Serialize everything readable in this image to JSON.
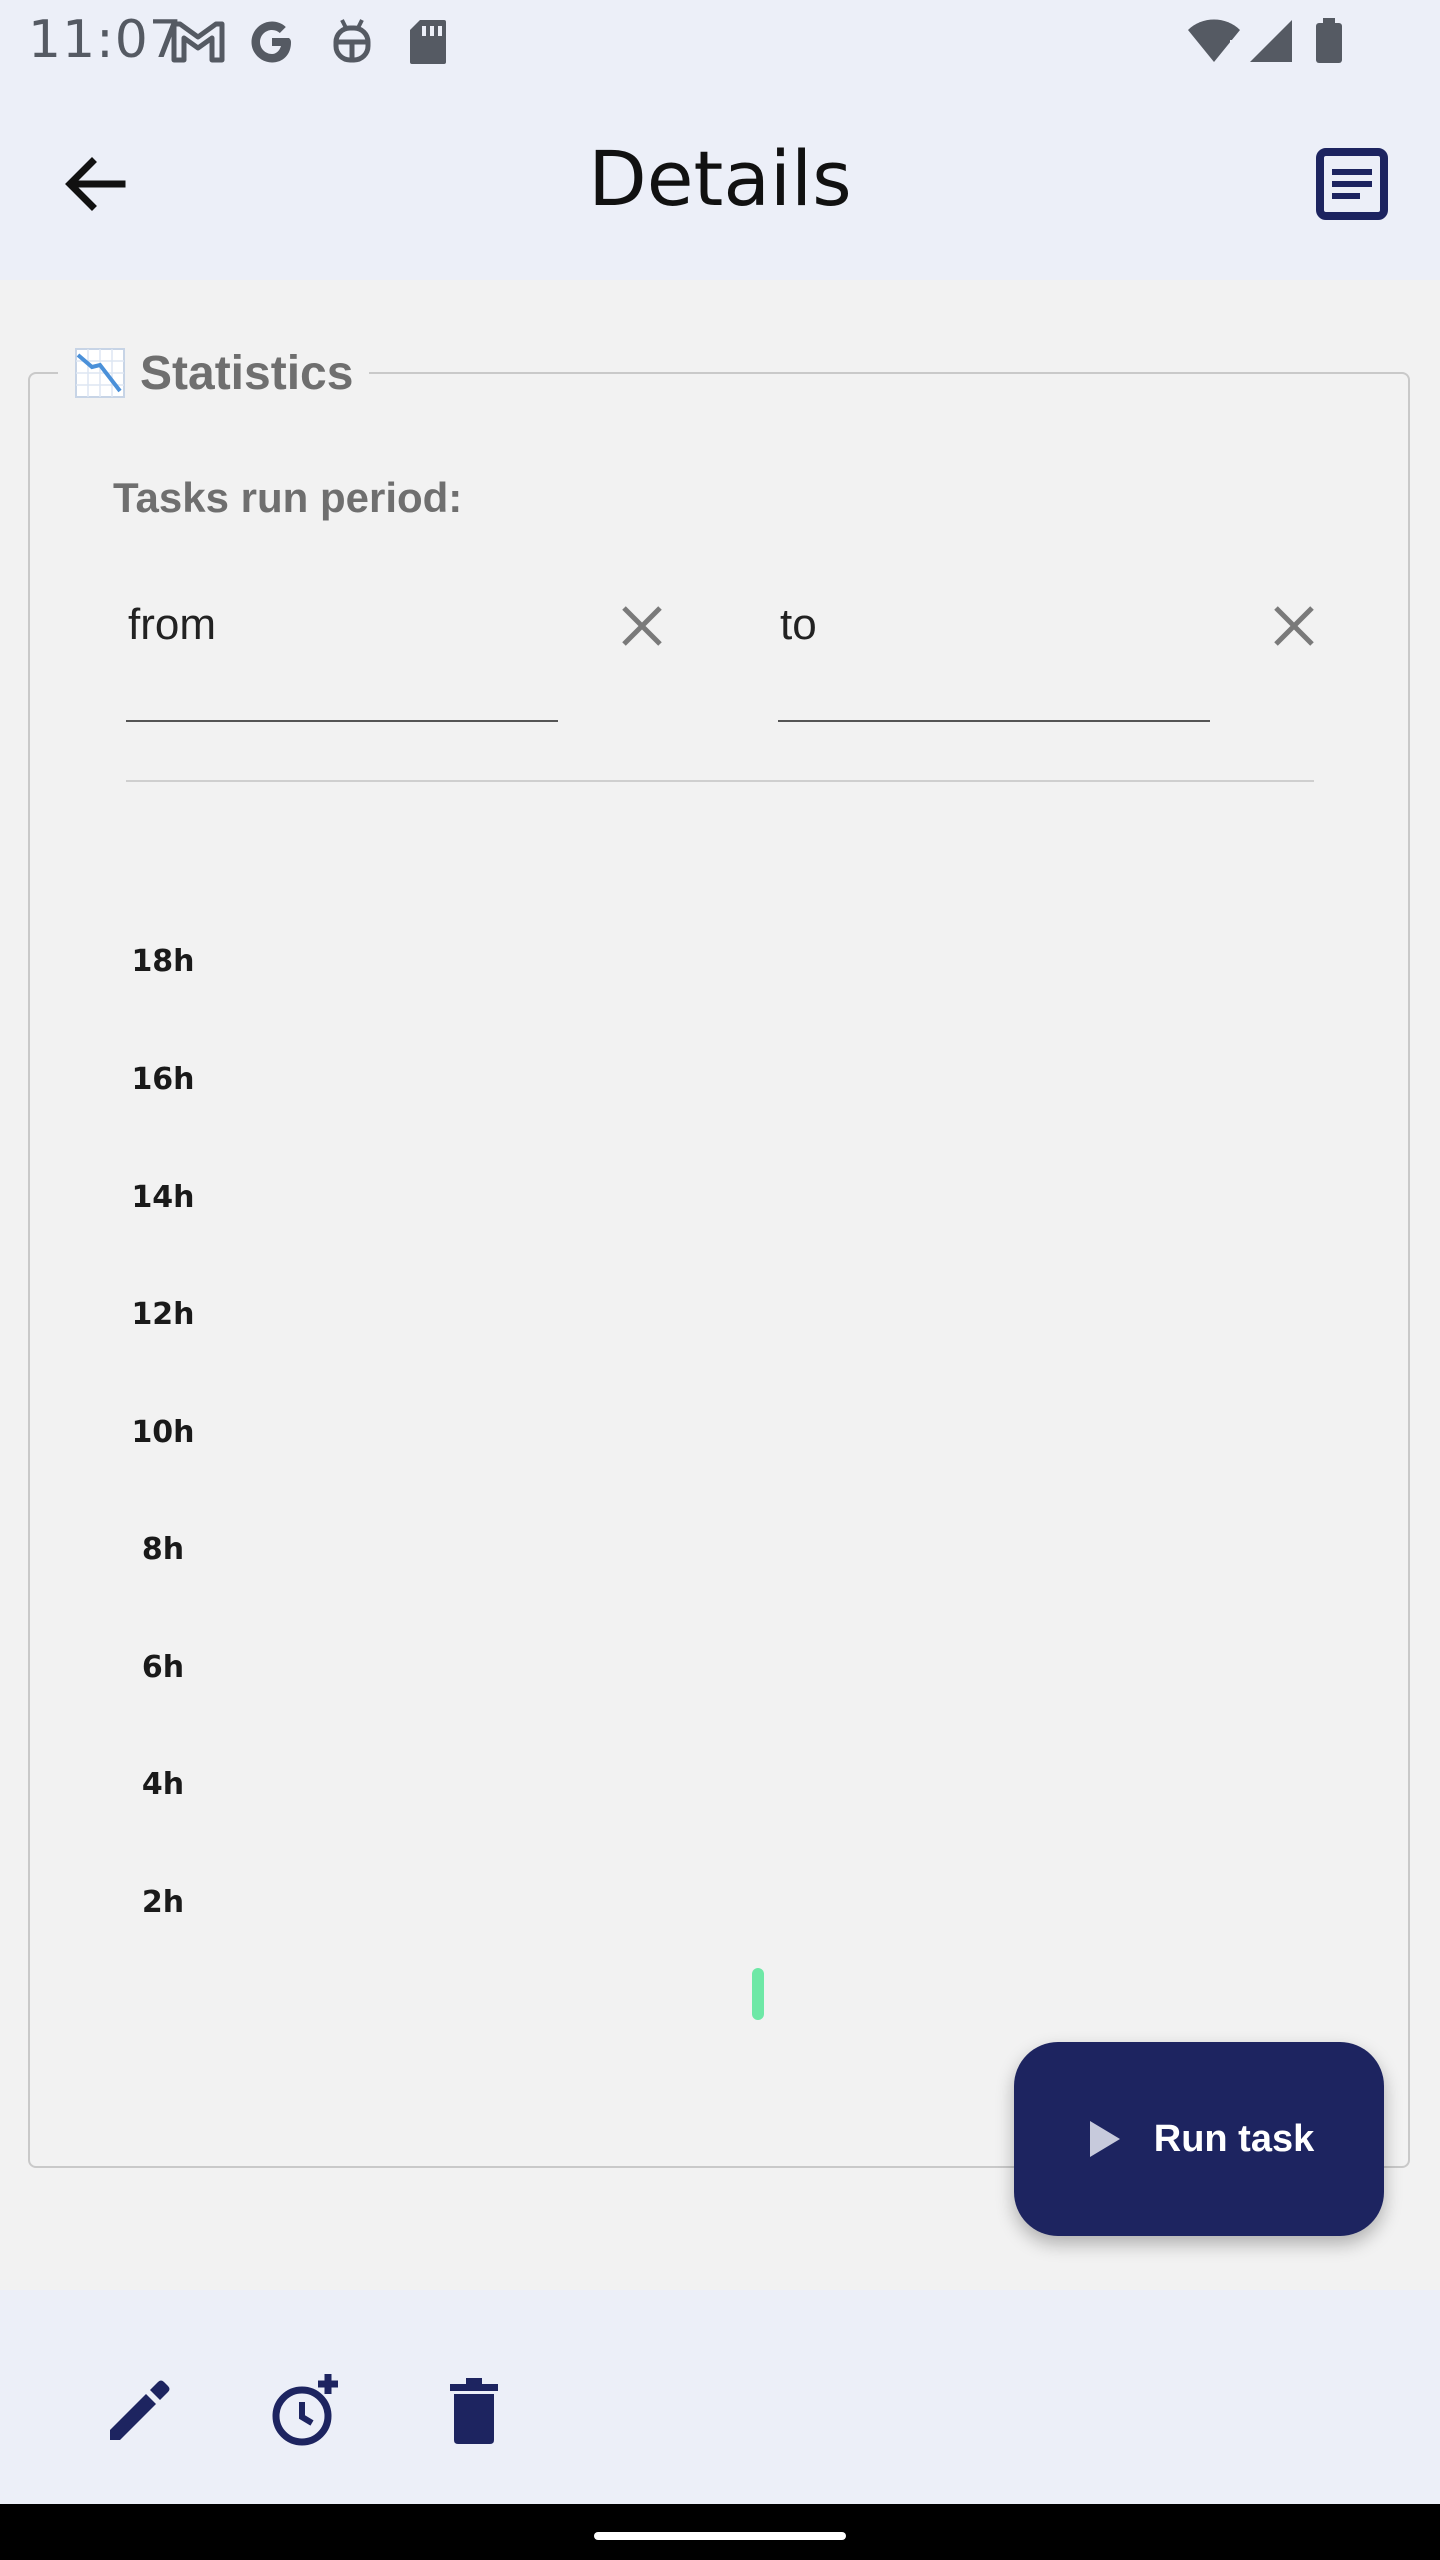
{
  "status_bar": {
    "time": "11:07",
    "icons_left": [
      "gmail-icon",
      "google-icon",
      "android-debug-icon",
      "sd-card-icon"
    ],
    "icons_right": [
      "wifi-icon",
      "signal-icon",
      "battery-icon"
    ]
  },
  "app_bar": {
    "title": "Details",
    "back_icon": "arrow-back-icon",
    "action_icon": "article-icon"
  },
  "statistics": {
    "legend_icon": "chart-decreasing-icon",
    "legend_label": "Statistics",
    "period_label": "Tasks run period:",
    "from_field": {
      "value": "from",
      "clear_icon": "close-icon"
    },
    "to_field": {
      "value": "to",
      "clear_icon": "close-icon"
    }
  },
  "chart_data": {
    "type": "bar",
    "y_ticks": [
      "18h",
      "16h",
      "14h",
      "12h",
      "10h",
      "8h",
      "6h",
      "4h",
      "2h"
    ],
    "series_color": "#6ee8a6",
    "values": [
      0
    ]
  },
  "run_button": {
    "label": "Run task",
    "icon": "play-icon"
  },
  "bottom_bar": {
    "icons": [
      "edit-icon",
      "schedule-add-icon",
      "delete-icon"
    ]
  },
  "colors": {
    "app_bar_bg": "#eceff8",
    "fab_bg": "#1d2460",
    "page_bg": "#f2f2f2"
  }
}
